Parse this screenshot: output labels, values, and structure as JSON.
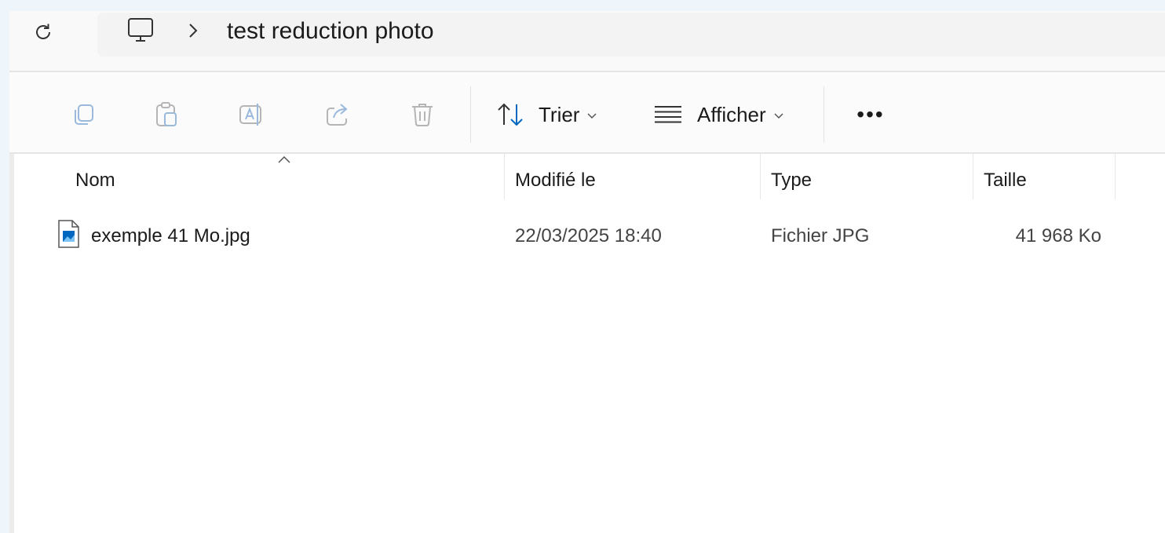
{
  "breadcrumb": {
    "path": "test reduction photo"
  },
  "toolbar": {
    "sort_label": "Trier",
    "view_label": "Afficher",
    "more_label": "•••"
  },
  "columns": {
    "name": "Nom",
    "modified": "Modifié le",
    "type": "Type",
    "size": "Taille"
  },
  "files": [
    {
      "name": "exemple 41 Mo.jpg",
      "modified": "22/03/2025 18:40",
      "type": "Fichier JPG",
      "size": "41 968 Ko"
    }
  ],
  "colors": {
    "accent": "#0067c0",
    "background": "#eef6fc"
  }
}
